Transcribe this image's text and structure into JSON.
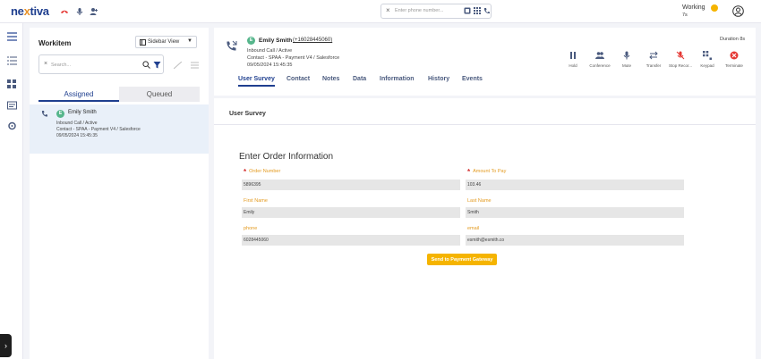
{
  "app": {
    "logo": "nextiva"
  },
  "header": {
    "phone_search_placeholder": "Enter phone number...",
    "status": {
      "label": "Working",
      "time": "7s",
      "color": "#f5b400"
    }
  },
  "workitem_panel": {
    "title": "Workitem",
    "view_select": "Sidebar View",
    "search_placeholder": "Search...",
    "tabs": [
      {
        "label": "Assigned"
      },
      {
        "label": "Queued"
      }
    ],
    "items": [
      {
        "name": "Emily Smith",
        "lines": [
          "Inbound Call / Active",
          "Contact - SPAA - Payment V4 / Salesforce",
          "09/05/2024 15:45:35"
        ]
      }
    ]
  },
  "call": {
    "name": "Emily Smith",
    "number": "(+16028445060)",
    "line1": "Inbound Call / Active",
    "line2": "Contact - SPAA - Payment V4 / Salesforce",
    "timestamp": "09/05/2024 15:45:35",
    "duration": "Duration 8s",
    "actions": [
      {
        "label": "Hold",
        "icon": "pause-icon"
      },
      {
        "label": "Conference",
        "icon": "conference-icon"
      },
      {
        "label": "Mute",
        "icon": "microphone-icon"
      },
      {
        "label": "Transfer",
        "icon": "transfer-icon"
      },
      {
        "label": "Stop Recor...",
        "icon": "stop-recording-icon"
      },
      {
        "label": "Keypad",
        "icon": "keypad-icon"
      },
      {
        "label": "Terminate",
        "icon": "terminate-icon"
      }
    ]
  },
  "tabs": [
    {
      "label": "User Survey",
      "active": true
    },
    {
      "label": "Contact"
    },
    {
      "label": "Notes"
    },
    {
      "label": "Data"
    },
    {
      "label": "Information"
    },
    {
      "label": "History"
    },
    {
      "label": "Events"
    }
  ],
  "survey": {
    "title": "User Survey",
    "form_title": "Enter Order Information",
    "fields": [
      {
        "label": "Order Number",
        "required": true,
        "value": "5896395"
      },
      {
        "label": "Amount To Pay",
        "required": true,
        "value": "103.46"
      },
      {
        "label": "First Name",
        "required": false,
        "value": "Emily"
      },
      {
        "label": "Last Name",
        "required": false,
        "value": "Smith"
      },
      {
        "label": "phone",
        "required": false,
        "value": "6028445060"
      },
      {
        "label": "email",
        "required": false,
        "value": "esmith@esmith.co"
      }
    ],
    "submit_label": "Send to Payment Gateway"
  },
  "colors": {
    "brand": "#1f3f8f",
    "accent": "#f5b400",
    "label": "#e39a1f",
    "required": "#d32f2f",
    "terminate": "#e53935"
  }
}
